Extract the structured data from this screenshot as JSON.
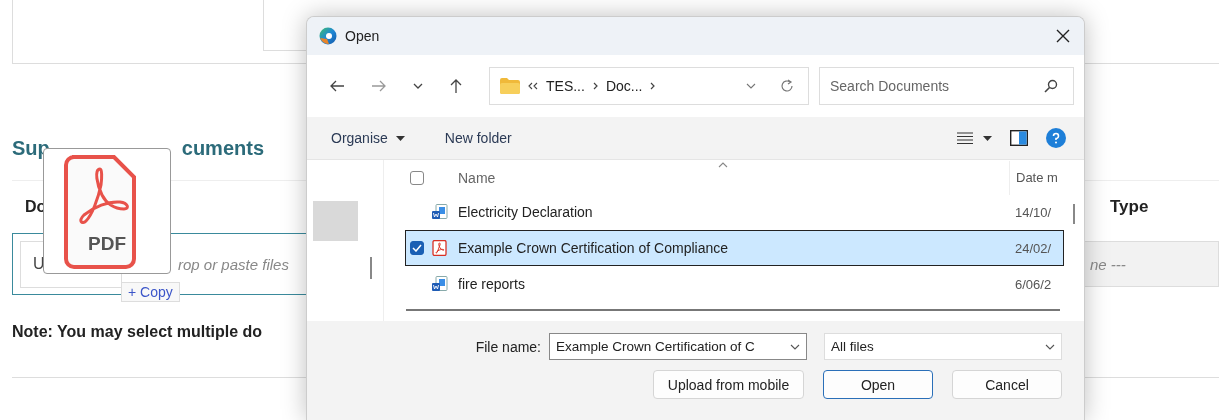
{
  "page": {
    "heading_parts": [
      "Sup",
      "cuments"
    ],
    "table_columns": [
      {
        "label": "Do"
      },
      {
        "label": "Type"
      }
    ],
    "upload_button": "U",
    "drop_hint": "rop or paste files",
    "type_select": "ne ---",
    "note": "Note: You may select multiple do"
  },
  "drag_preview": {
    "file_label": "PDF",
    "action": "+ Copy"
  },
  "dialog": {
    "title": "Open",
    "breadcrumb": [
      "TES...",
      "Doc..."
    ],
    "search": {
      "placeholder": "Search Documents"
    },
    "toolbar": [
      {
        "label": "Organise",
        "has_menu": true
      },
      {
        "label": "New folder",
        "has_menu": false
      }
    ],
    "select_all_checked": false,
    "columns": [
      "Name",
      "Date m"
    ],
    "files": [
      {
        "name": "Electricity Declaration",
        "date": "14/10/",
        "kind": "word",
        "selected": false,
        "checked": false
      },
      {
        "name": "Example Crown Certification of Compliance",
        "date": "24/02/",
        "kind": "pdf",
        "selected": true,
        "checked": true
      },
      {
        "name": "fire reports",
        "date": "6/06/2",
        "kind": "word",
        "selected": false,
        "checked": false
      }
    ],
    "file_name_label": "File name:",
    "file_name": "Example Crown Certification of C",
    "file_type": "All files",
    "buttons": [
      {
        "label": "Upload from mobile",
        "default": false
      },
      {
        "label": "Open",
        "default": true
      },
      {
        "label": "Cancel",
        "default": false
      }
    ]
  }
}
